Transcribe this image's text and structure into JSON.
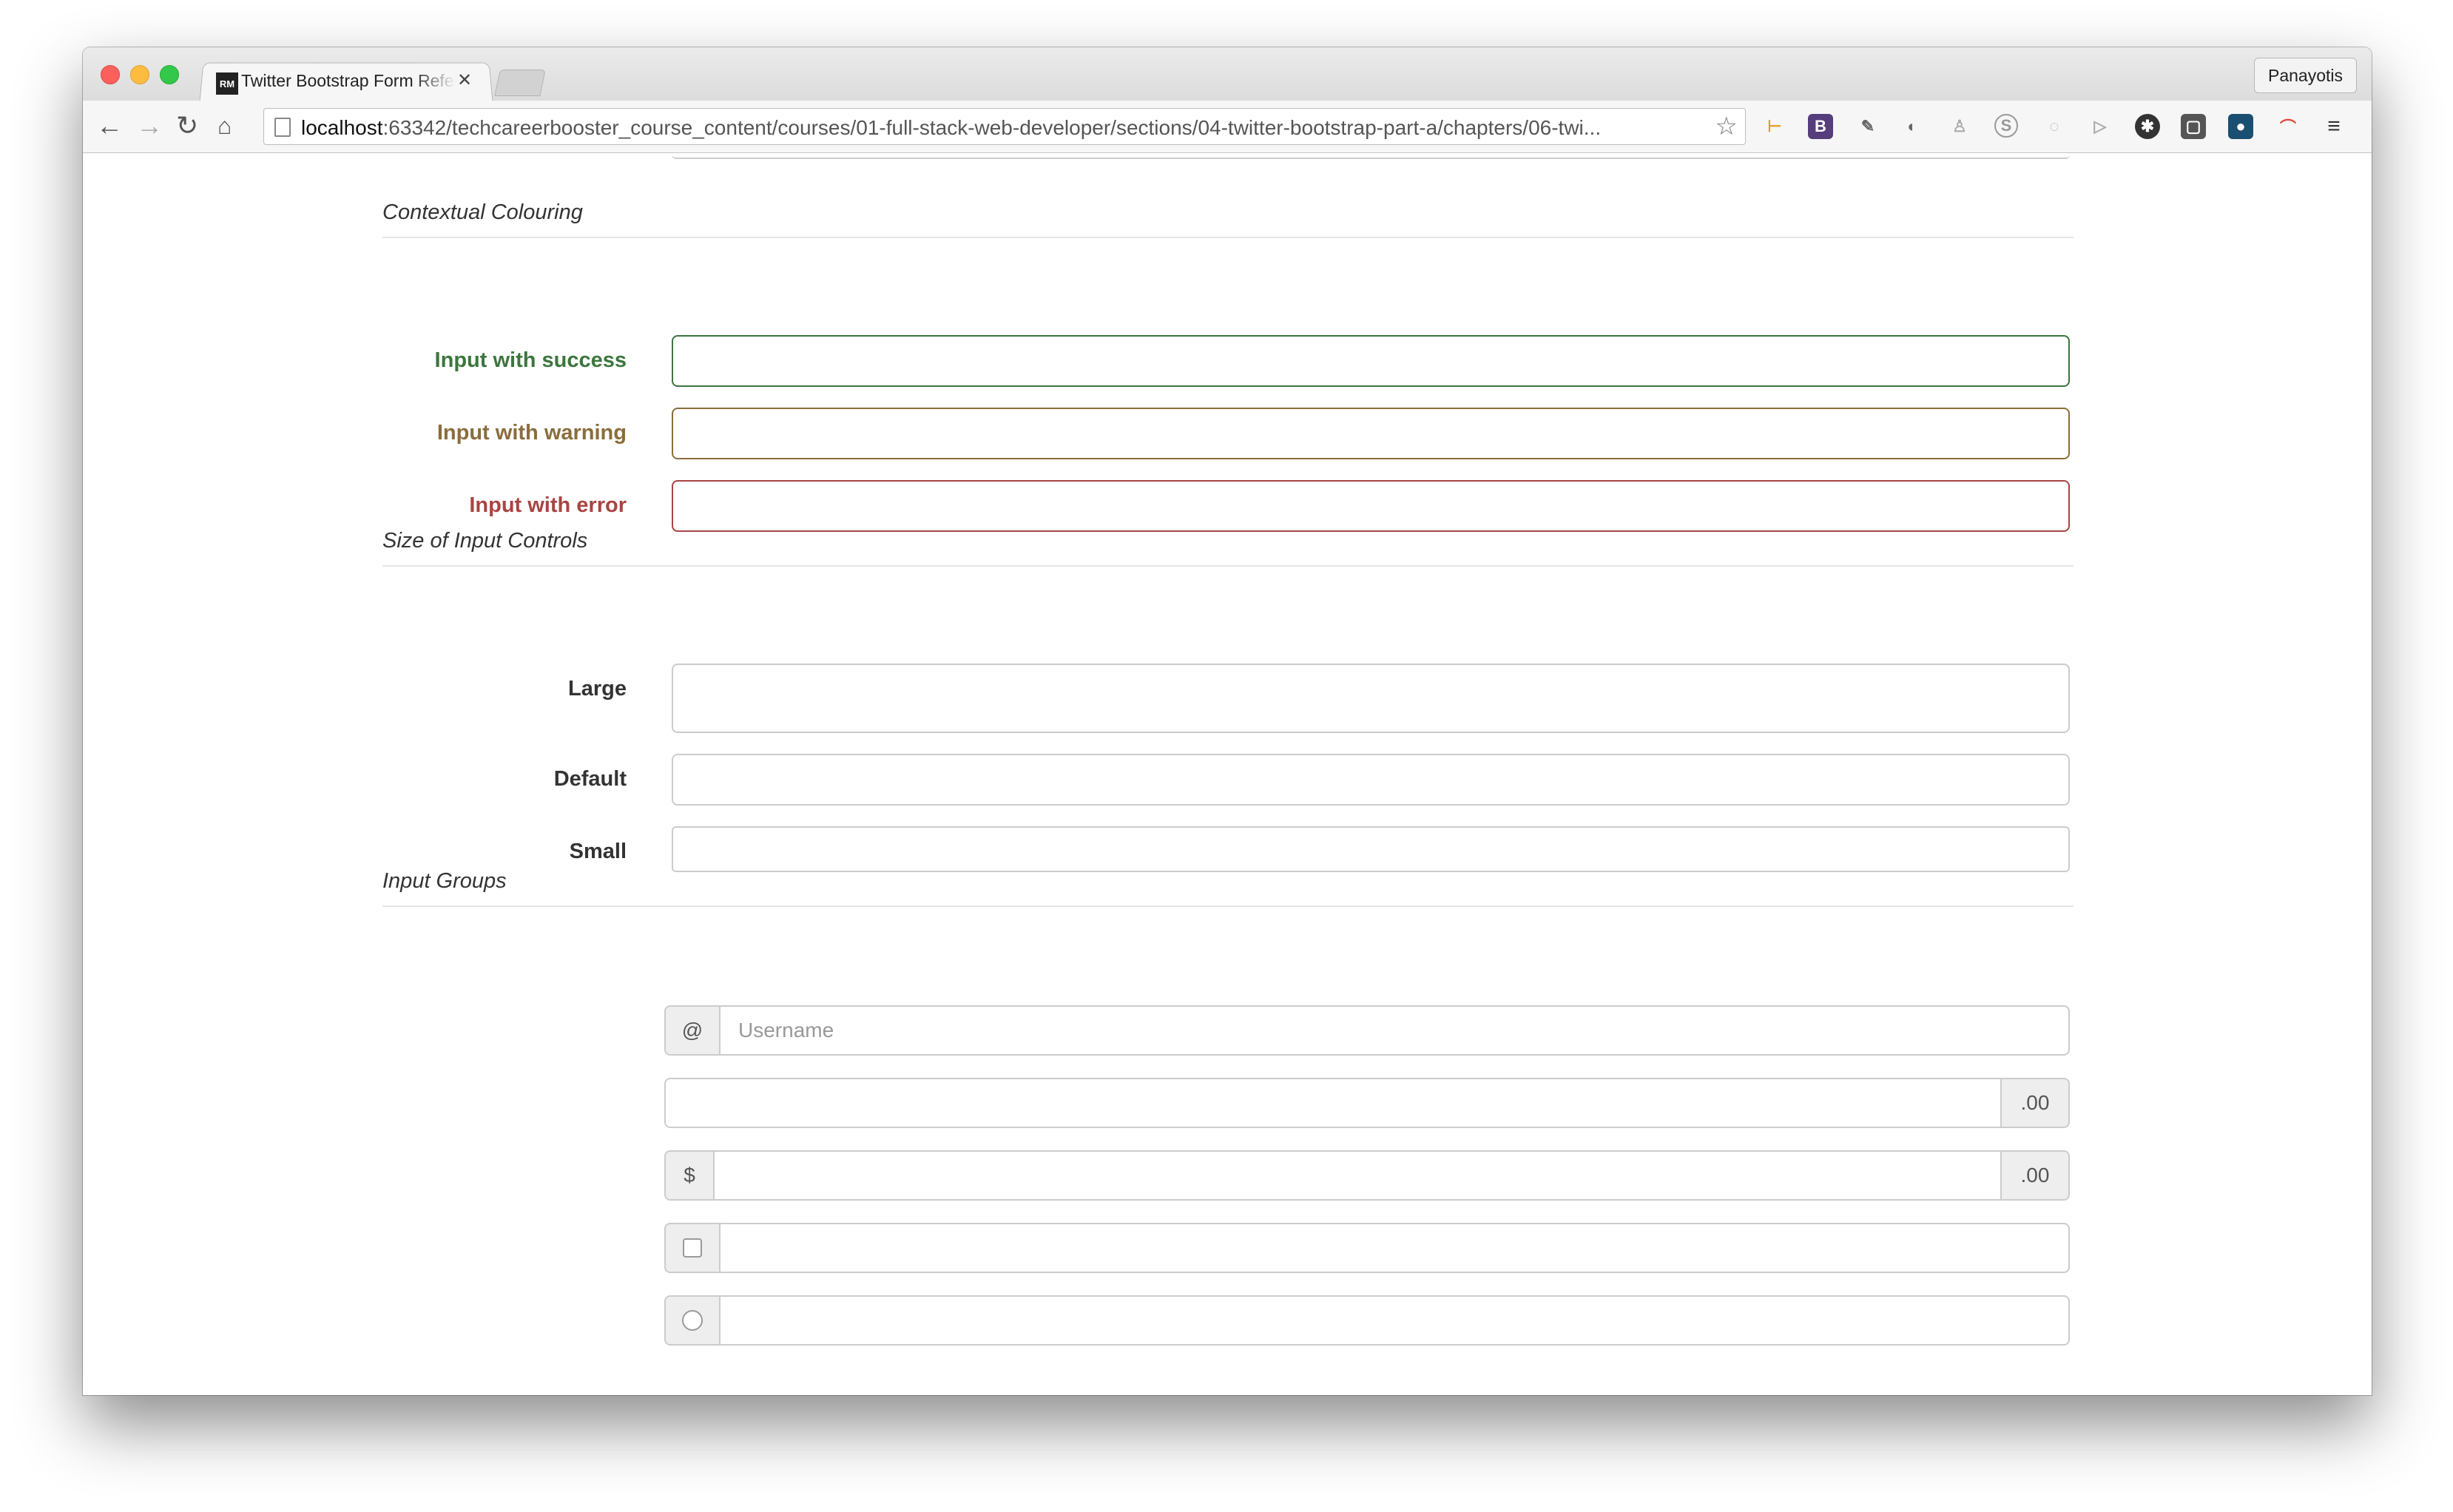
{
  "browser": {
    "tab_title": "Twitter Bootstrap Form Reference",
    "tab_favicon_text": "RM",
    "profile_name": "Panayotis",
    "url_host": "localhost",
    "url_rest": ":63342/techcareerbooster_course_content/courses/01-full-stack-web-developer/sections/04-twitter-bootstrap-part-a/chapters/06-twi..."
  },
  "sections": {
    "contextual": {
      "legend": "Contextual Colouring",
      "success_label": "Input with success",
      "warning_label": "Input with warning",
      "error_label": "Input with error"
    },
    "sizes": {
      "legend": "Size of Input Controls",
      "large_label": "Large",
      "default_label": "Default",
      "small_label": "Small"
    },
    "groups": {
      "legend": "Input Groups",
      "at_addon": "@",
      "username_placeholder": "Username",
      "cents_addon": ".00",
      "dollar_addon": "$",
      "cents_addon_2": ".00"
    }
  },
  "colors": {
    "success": "#3c763d",
    "warning": "#8a6d3b",
    "error": "#a94442"
  }
}
